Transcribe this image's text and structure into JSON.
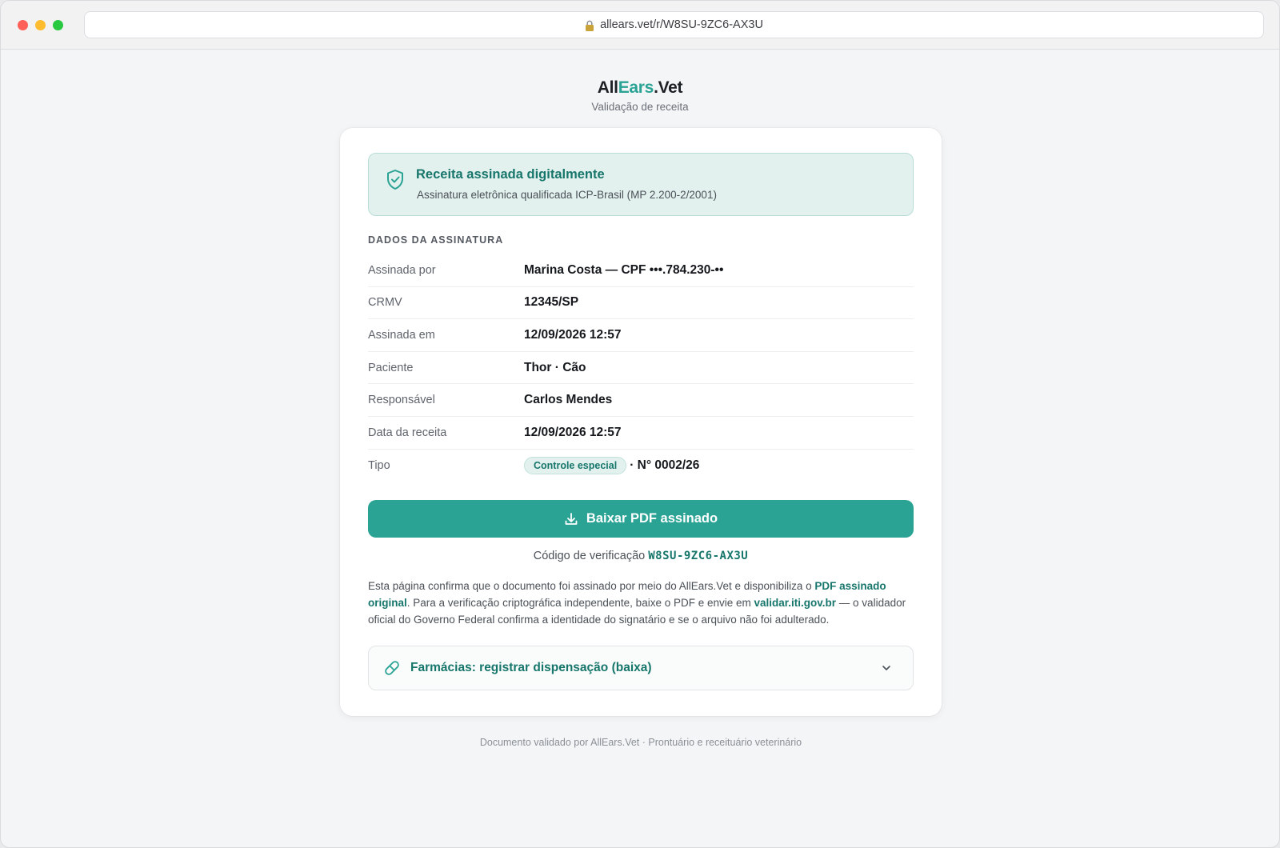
{
  "browser": {
    "url": "allears.vet/r/W8SU-9ZC6-AX3U"
  },
  "brand": {
    "name_part1": "All",
    "name_part2": "Ears",
    "name_part3": ".Vet",
    "subtitle": "Validação de receita",
    "accent_color": "#2aa395"
  },
  "banner": {
    "title": "Receita assinada digitalmente",
    "subtitle": "Assinatura eletrônica qualificada ICP-Brasil (MP 2.200-2/2001)",
    "icon": "shield-check-icon"
  },
  "signature": {
    "section_title": "DADOS DA ASSINATURA",
    "rows": [
      {
        "label": "Assinada por",
        "value": "Marina Costa — CPF •••.784.230-••"
      },
      {
        "label": "CRMV",
        "value": "12345/SP"
      },
      {
        "label": "Assinada em",
        "value": "12/09/2026 12:57"
      },
      {
        "label": "Paciente",
        "value": "Thor · Cão"
      },
      {
        "label": "Responsável",
        "value": "Carlos Mendes"
      },
      {
        "label": "Data da receita",
        "value": "12/09/2026 12:57"
      }
    ],
    "type_row": {
      "label": "Tipo",
      "tag": "Controle especial",
      "number": "· N° 0002/26"
    }
  },
  "download": {
    "label": "Baixar PDF assinado",
    "icon": "download-icon"
  },
  "verification": {
    "label": "Código de verificação",
    "code": "W8SU-9ZC6-AX3U"
  },
  "explanation": {
    "part1": "Esta página confirma que o documento foi assinado por meio do AllEars.Vet e disponibiliza o ",
    "link1": "PDF assinado original",
    "part2": ". Para a verificação criptográfica independente, baixe o PDF e envie em ",
    "link2": "validar.iti.gov.br",
    "part3": " — o validador oficial do Governo Federal confirma a identidade do signatário e se o arquivo não foi adulterado."
  },
  "pharmacy": {
    "label": "Farmácias: registrar dispensação (baixa)",
    "icon": "pill-icon"
  },
  "footer": {
    "text": "Documento validado por AllEars.Vet · Prontuário e receituário veterinário"
  }
}
